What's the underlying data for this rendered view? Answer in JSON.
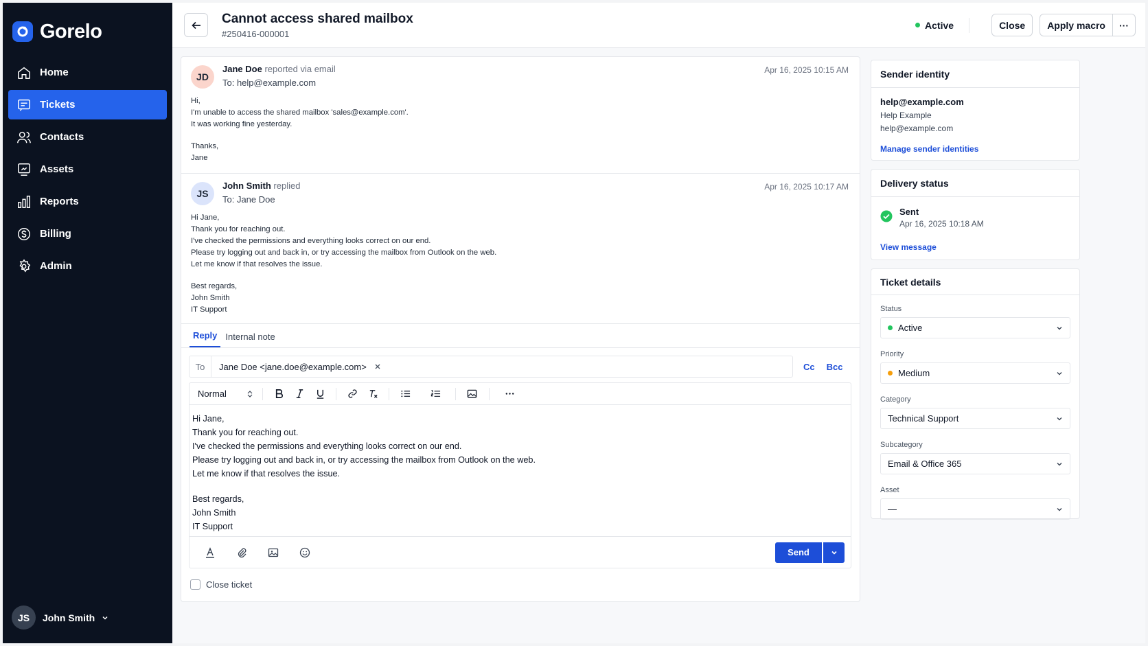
{
  "brand": {
    "name": "Gorelo"
  },
  "sidebar": {
    "items": [
      {
        "label": "Home",
        "icon": "home-icon"
      },
      {
        "label": "Tickets",
        "icon": "ticket-icon"
      },
      {
        "label": "Contacts",
        "icon": "contacts-icon"
      },
      {
        "label": "Assets",
        "icon": "assets-icon"
      },
      {
        "label": "Reports",
        "icon": "reports-icon"
      },
      {
        "label": "Billing",
        "icon": "billing-icon"
      },
      {
        "label": "Admin",
        "icon": "gear-icon"
      }
    ],
    "active": "Tickets",
    "user": {
      "initials": "JS",
      "name": "John Smith"
    }
  },
  "header": {
    "title": "Cannot access shared mailbox",
    "ticket_id": "#250416-000001",
    "status": "Active",
    "close_label": "Close",
    "macro_label": "Apply macro",
    "more_label": "···"
  },
  "messages": [
    {
      "initials": "JD",
      "author": "Jane Doe",
      "action": "reported via email",
      "to": "To: help@example.com",
      "time": "Apr 16, 2025 10:15 AM",
      "body": [
        "Hi,",
        "I'm unable to access the shared mailbox 'sales@example.com'.",
        "It was working fine yesterday.",
        "",
        "Thanks,",
        "Jane"
      ]
    },
    {
      "initials": "JS",
      "author": "John Smith",
      "action": "replied",
      "to": "To: Jane Doe",
      "time": "Apr 16, 2025 10:17 AM",
      "body": [
        "Hi Jane,",
        "Thank you for reaching out.",
        "I've checked the permissions and everything looks correct on our end.",
        "Please try logging out and back in, or try accessing the mailbox from Outlook on the web.",
        "Let me know if that resolves the issue.",
        "",
        "Best regards,",
        "John Smith",
        "IT Support"
      ]
    }
  ],
  "composer": {
    "tabs": [
      "Reply",
      "Internal note"
    ],
    "active_tab": "Reply",
    "to_label": "To",
    "recipient": "Jane Doe <jane.doe@example.com>",
    "cc": "Cc",
    "bcc": "Bcc",
    "format": "Normal",
    "body": [
      "Hi Jane,",
      "Thank you for reaching out.",
      "I've checked the permissions and everything looks correct on our end.",
      "Please try logging out and back in, or try accessing the mailbox from Outlook on the web.",
      "Let me know if that resolves the issue.",
      "",
      "Best regards,",
      "John Smith",
      "IT Support"
    ],
    "send_label": "Send",
    "close_ticket_label": "Close ticket"
  },
  "sender_identity": {
    "title": "Sender identity",
    "email": "help@example.com",
    "name": "Help Example",
    "address": "help@example.com",
    "link": "Manage sender identities"
  },
  "delivery": {
    "title": "Delivery status",
    "status": "Sent",
    "time": "Apr 16, 2025 10:18 AM",
    "link": "View message"
  },
  "ticket_details": {
    "title": "Ticket details",
    "fields": [
      {
        "label": "Status",
        "value": "Active",
        "dot": "#22c55e"
      },
      {
        "label": "Priority",
        "value": "Medium",
        "dot": "#f59e0b"
      },
      {
        "label": "Category",
        "value": "Technical Support"
      },
      {
        "label": "Subcategory",
        "value": "Email & Office 365"
      },
      {
        "label": "Asset",
        "value": "—"
      }
    ]
  },
  "colors": {
    "accent": "#2563eb",
    "sidebar": "#0b1220",
    "active_green": "#22c55e",
    "medium_amber": "#f59e0b"
  }
}
